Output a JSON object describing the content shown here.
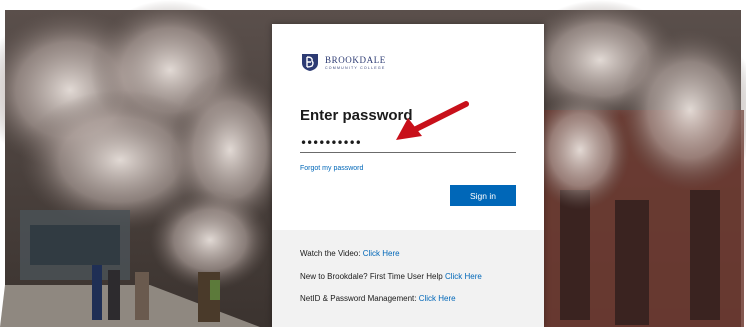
{
  "brand": {
    "name": "BROOKDALE",
    "subtitle": "COMMUNITY COLLEGE",
    "color": "#2d3b73"
  },
  "signin_form": {
    "title": "Enter password",
    "password_value": "••••••••••",
    "forgot_link": "Forgot my password",
    "sign_in_button": "Sign in",
    "accent_color": "#0067b8"
  },
  "help_links": [
    {
      "prefix": "Watch the Video: ",
      "link": "Click Here"
    },
    {
      "prefix": "New to Brookdale? First Time User Help ",
      "link": "Click Here"
    },
    {
      "prefix": "NetID & Password Management: ",
      "link": "Click Here"
    }
  ],
  "annotation": {
    "arrow_color": "#c8101a"
  }
}
